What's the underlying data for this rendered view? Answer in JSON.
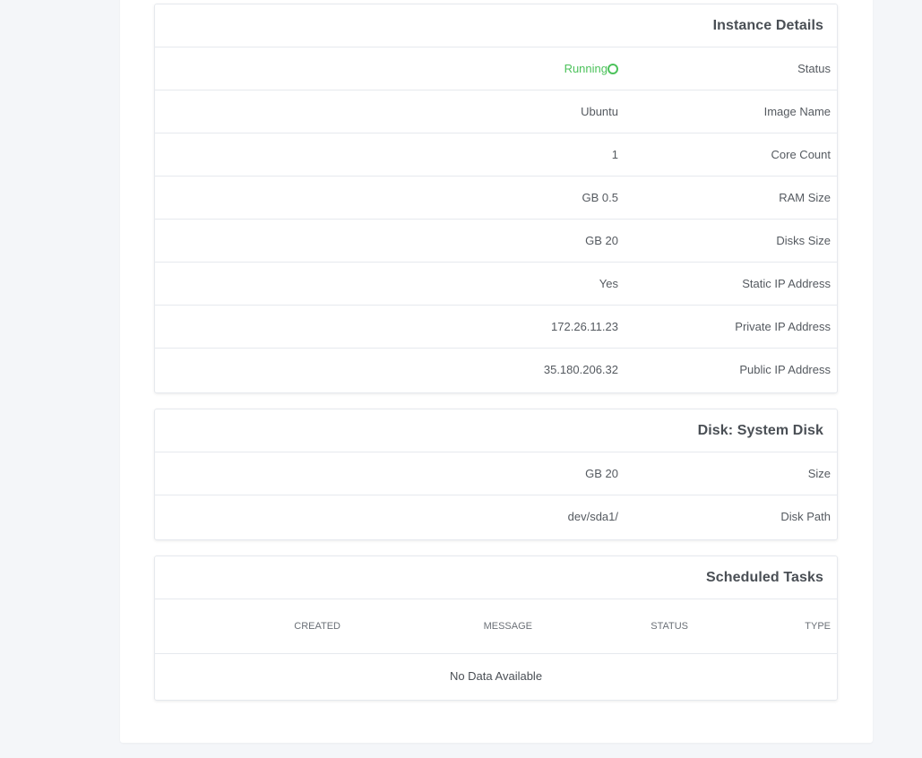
{
  "instance_details": {
    "title": "Instance Details",
    "rows": [
      {
        "label": "Status",
        "value": "Running"
      },
      {
        "label": "Image Name",
        "value": "Ubuntu"
      },
      {
        "label": "Core Count",
        "value": "1"
      },
      {
        "label": "RAM Size",
        "value": "GB 0.5"
      },
      {
        "label": "Disks Size",
        "value": "GB 20"
      },
      {
        "label": "Static IP Address",
        "value": "Yes"
      },
      {
        "label": "Private IP Address",
        "value": "172.26.11.23"
      },
      {
        "label": "Public IP Address",
        "value": "35.180.206.32"
      }
    ]
  },
  "disk": {
    "title": "Disk: System Disk",
    "rows": [
      {
        "label": "Size",
        "value": "GB 20"
      },
      {
        "label": "Disk Path",
        "value": "dev/sda1/"
      }
    ]
  },
  "scheduled_tasks": {
    "title": "Scheduled Tasks",
    "columns": [
      "TYPE",
      "STATUS",
      "MESSAGE",
      "CREATED"
    ],
    "empty_text": "No Data Available"
  },
  "colors": {
    "status_running": "#4cc25b",
    "background": "#f4f6f9",
    "card_border": "#e6e9ee"
  },
  "icons": {
    "status_indicator": "status-ring-icon"
  }
}
